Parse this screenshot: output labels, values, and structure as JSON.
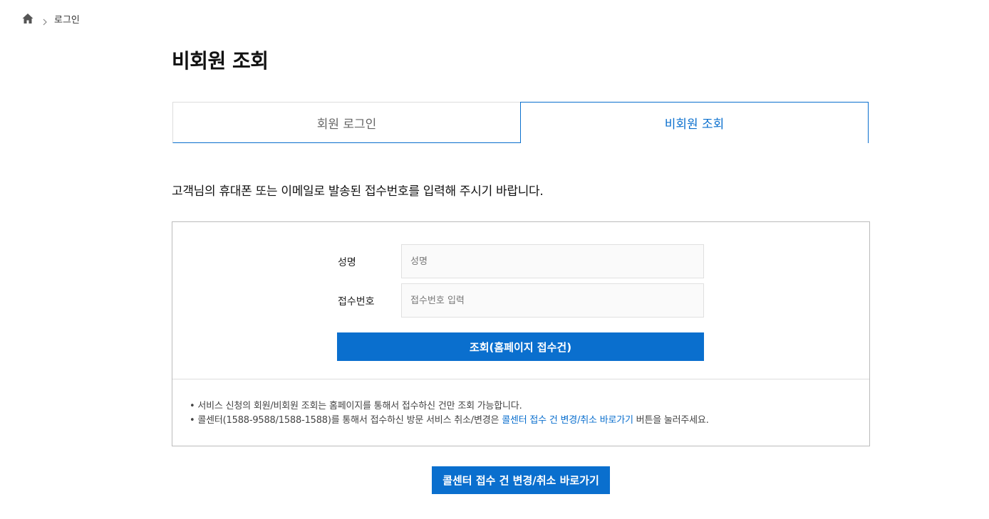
{
  "breadcrumb": {
    "home_icon": "home-icon",
    "separator_icon": "chevron-right-icon",
    "current": "로그인"
  },
  "page": {
    "title": "비회원 조회"
  },
  "tabs": [
    {
      "label": "회원 로그인",
      "active": false
    },
    {
      "label": "비회원 조회",
      "active": true
    }
  ],
  "intro": "고객님의 휴대폰 또는 이메일로 발송된 접수번호를 입력해 주시기 바랍니다.",
  "form": {
    "name_label": "성명",
    "name_placeholder": "성명",
    "name_value": "",
    "number_label": "접수번호",
    "number_placeholder": "접수번호 입력",
    "number_value": "",
    "submit_label": "조회(홈페이지 접수건)"
  },
  "notes": {
    "note1": "• 서비스 신청의 회원/비회원 조회는 홈페이지를 통해서 접수하신 건만 조회 가능합니다.",
    "note2_prefix": "• 콜센터(1588-9588/1588-1588)를 통해서 접수하신 방문 서비스 취소/변경은 ",
    "note2_link": "콜센터 접수 건 변경/취소 바로가기",
    "note2_suffix": " 버튼을 눌러주세요."
  },
  "callcenter_button_label": "콜센터 접수 건 변경/취소 바로가기",
  "colors": {
    "accent": "#0a6fce",
    "border": "#bbbbbb",
    "input_bg": "#fafafa"
  }
}
